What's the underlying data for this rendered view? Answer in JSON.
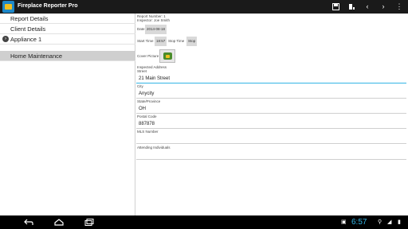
{
  "app": {
    "title": "Fireplace Reporter Pro"
  },
  "actionbar": {
    "icons": [
      "save-icon",
      "settings-icon",
      "previous-icon",
      "next-icon",
      "overflow-menu-icon"
    ]
  },
  "nav": {
    "items": [
      {
        "label": "Report Details"
      },
      {
        "label": "Client Details"
      },
      {
        "label": "Appliance 1"
      },
      {
        "label": "Home Maintenance"
      }
    ],
    "selected_index": 3
  },
  "form": {
    "report_number": "Report Number: 1",
    "inspector": "Inspector: Joe Smith",
    "date_label": "Date",
    "date_value": "2014-08-18",
    "start_time_label": "Start Time",
    "start_time_value": "18:57",
    "stop_time_label": "Stop Time",
    "stop_button": "Stop",
    "cover_picture_label": "Cover Picture",
    "inspected_address_label": "Inspected Address",
    "street_label": "Street",
    "street_value": "21 Main Street",
    "city_label": "City",
    "city_value": "Anycity",
    "state_label": "State/Province",
    "state_value": "OH",
    "postal_label": "Postal Code",
    "postal_value": "887878",
    "mls_label": "MLS Number",
    "mls_value": "",
    "attending_label": "Attending Individuals",
    "attending_value": ""
  },
  "system_bar": {
    "time": "6:57"
  },
  "colors": {
    "actionbar": "#1a1a1a",
    "accent": "#33b5e5",
    "selected_row": "#cfcfcf"
  }
}
